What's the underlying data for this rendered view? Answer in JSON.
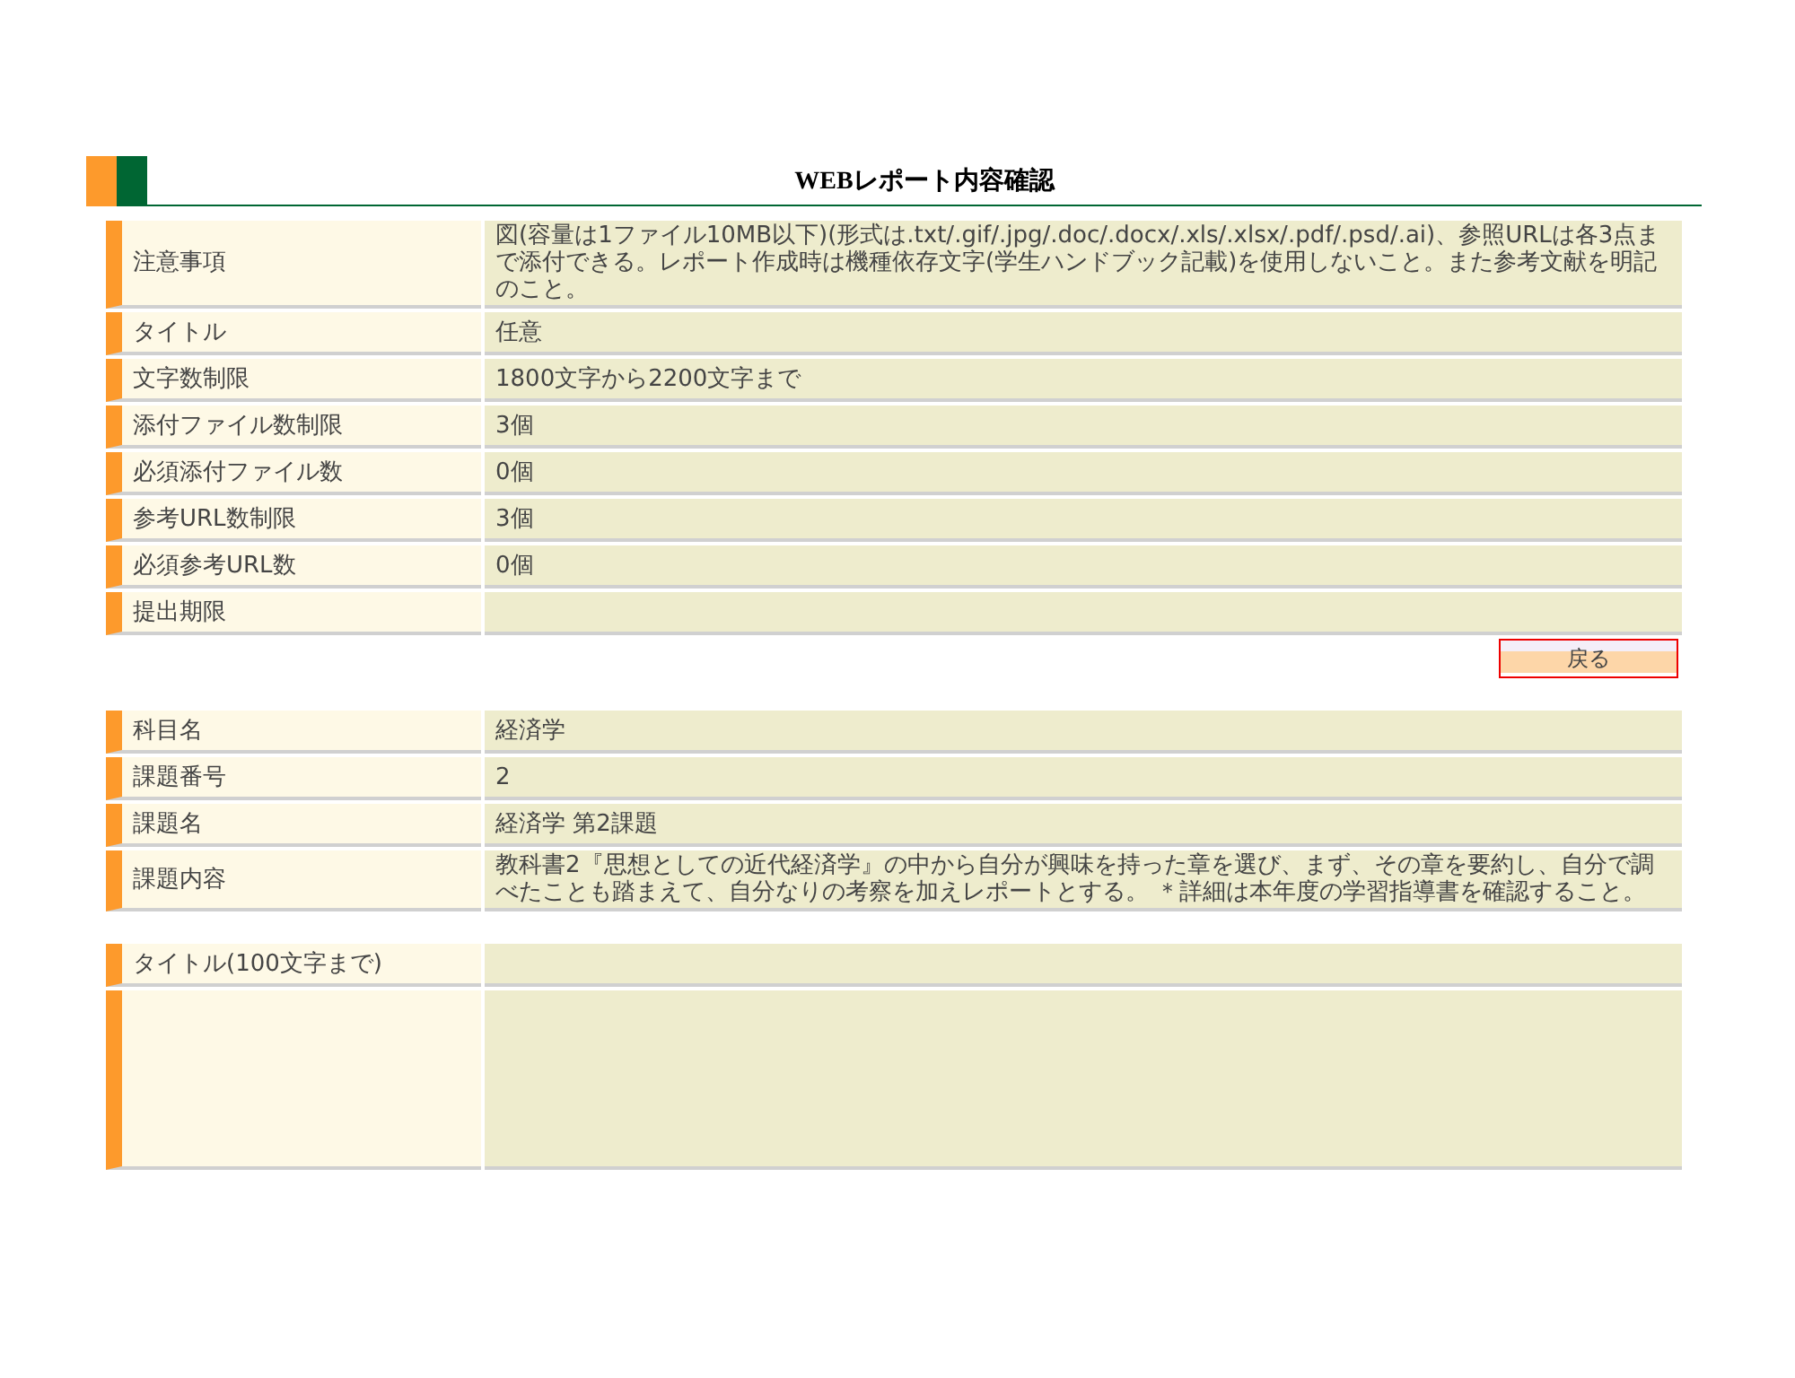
{
  "header": {
    "title": "WEBレポート内容確認"
  },
  "requirements": [
    {
      "label": "注意事項",
      "value": "図(容量は1ファイル10MB以下)(形式は.txt/.gif/.jpg/.doc/.docx/.xls/.xlsx/.pdf/.psd/.ai)、参照URLは各3点まで添付できる。レポート作成時は機種依存文字(学生ハンドブック記載)を使用しないこと。また参考文献を明記のこと。"
    },
    {
      "label": "タイトル",
      "value": "任意"
    },
    {
      "label": "文字数制限",
      "value": "1800文字から2200文字まで"
    },
    {
      "label": "添付ファイル数制限",
      "value": "3個"
    },
    {
      "label": "必須添付ファイル数",
      "value": "0個"
    },
    {
      "label": "参考URL数制限",
      "value": "3個"
    },
    {
      "label": "必須参考URL数",
      "value": "0個"
    },
    {
      "label": "提出期限"
    }
  ],
  "back_button": {
    "label": "戻る"
  },
  "assignment": [
    {
      "label": "科目名",
      "value": "経済学"
    },
    {
      "label": "課題番号",
      "value": "2"
    },
    {
      "label": "課題名",
      "value": "経済学 第2課題"
    },
    {
      "label": "課題内容",
      "value": "教科書2『思想としての近代経済学』の中から自分が興味を持った章を選び、まず、その章を要約し、自分で調べたことも踏まえて、自分なりの考察を加えレポートとする。 ＊詳細は本年度の学習指導書を確認すること。"
    }
  ],
  "submission": [
    {
      "kind": "text_field",
      "label": "タイトル(100文字まで)"
    },
    {
      "kind": "text_area"
    }
  ]
}
